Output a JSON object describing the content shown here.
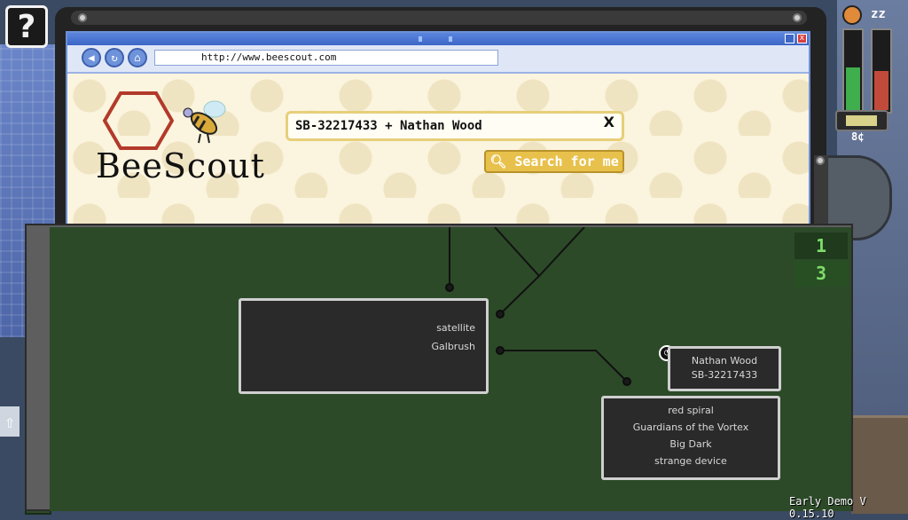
{
  "help": {
    "label": "?"
  },
  "browser": {
    "url": "http://www.beescout.com",
    "site_name": "BeeScout",
    "search_value": "SB-32217433 + Nathan Wood",
    "search_clear": "X",
    "search_button": "Search for me",
    "close_label": "x"
  },
  "status": {
    "money": "8¢",
    "hunger_level": 0.55,
    "sleep_level": 0.5,
    "energy_level": 0.7,
    "sleep_icon_text": "zz"
  },
  "board": {
    "page_tabs": [
      "1",
      "3"
    ],
    "nodes": [
      {
        "items": [
          "satellite",
          "Galbrush"
        ]
      },
      {
        "title": "Nathan Wood",
        "subtitle": "SB-32217433"
      },
      {
        "items": [
          "red spiral",
          "Guardians of the Vortex",
          "Big Dark",
          "strange device"
        ]
      }
    ]
  },
  "version": "Early Demo V 0.15.10",
  "colors": {
    "board_green": "#2c4a28",
    "search_yellow": "#e8c14c",
    "hunger_green": "#3fae4c",
    "sleep_red": "#c24a3a",
    "tab_green": "#7edc6a"
  }
}
